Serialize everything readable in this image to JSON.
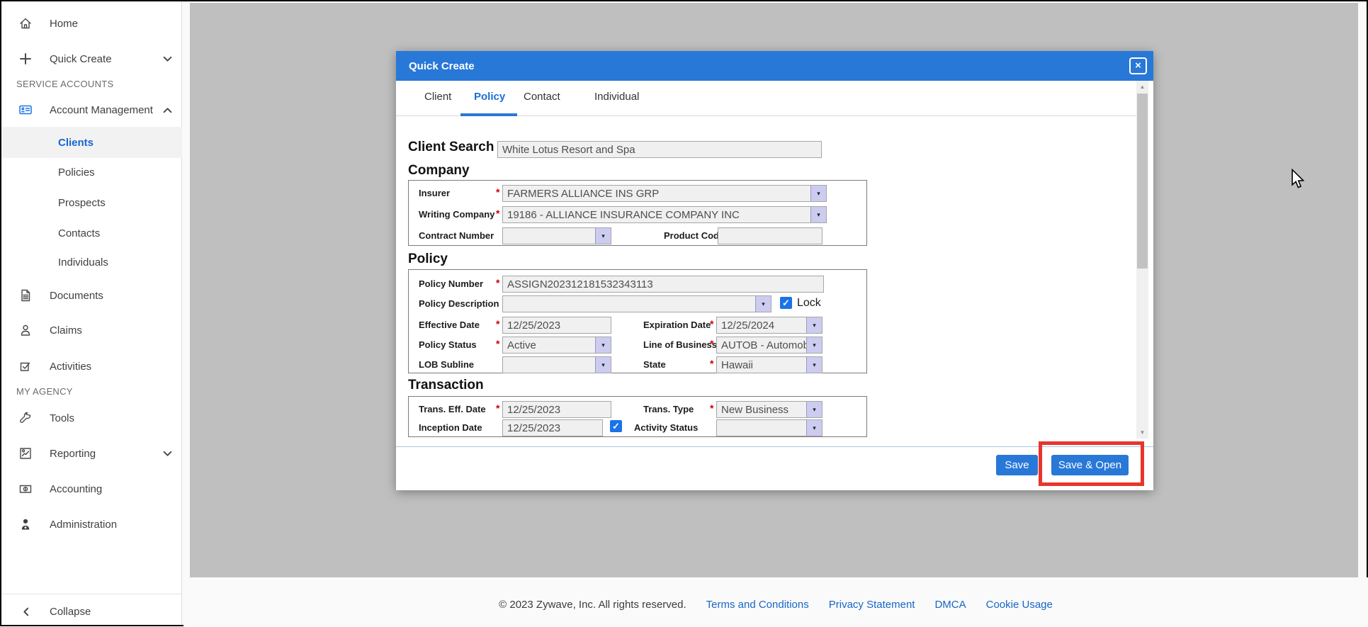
{
  "colors": {
    "accent_blue": "#2878d7",
    "annotation_red": "#e8352b",
    "link_blue": "#1766c8",
    "active_item_blue": "#1467d2",
    "checkbox_blue": "#1a73e8",
    "content_gray": "#bfbfbf"
  },
  "ui": {
    "required_marker": "*",
    "check_glyph": "✓",
    "dropdown_arrow": "▾",
    "scroll_up": "▲",
    "scroll_down": "▼",
    "close_glyph": "×"
  },
  "sidebar": {
    "home": "Home",
    "quick_create": "Quick Create",
    "section_service_accounts": "SERVICE ACCOUNTS",
    "account_management": "Account Management",
    "clients": "Clients",
    "policies": "Policies",
    "prospects": "Prospects",
    "contacts": "Contacts",
    "individuals": "Individuals",
    "documents": "Documents",
    "claims": "Claims",
    "activities": "Activities",
    "section_my_agency": "MY AGENCY",
    "tools": "Tools",
    "reporting": "Reporting",
    "accounting": "Accounting",
    "administration": "Administration",
    "collapse": "Collapse"
  },
  "modal": {
    "title": "Quick Create",
    "tabs": {
      "client": "Client",
      "policy": "Policy",
      "contact": "Contact",
      "individual": "Individual"
    },
    "client_search": {
      "label": "Client Search",
      "value": "White Lotus Resort and Spa"
    },
    "company": {
      "title": "Company",
      "insurer_label": "Insurer",
      "insurer_value": "FARMERS ALLIANCE INS GRP",
      "writing_label": "Writing Company",
      "writing_value": "19186 - ALLIANCE INSURANCE COMPANY INC",
      "contract_label": "Contract Number",
      "contract_value": "",
      "product_label": "Product Code",
      "product_value": ""
    },
    "policy": {
      "title": "Policy",
      "number_label": "Policy Number",
      "number_value": "ASSIGN202312181532343113",
      "description_label": "Policy Description",
      "description_value": "",
      "lock_label": "Lock",
      "effective_label": "Effective Date",
      "effective_value": "12/25/2023",
      "expiration_label": "Expiration Date",
      "expiration_value": "12/25/2024",
      "status_label": "Policy Status",
      "status_value": "Active",
      "lob_label": "Line of Business",
      "lob_value": "AUTOB - Automob",
      "subline_label": "LOB Subline",
      "subline_value": "",
      "state_label": "State",
      "state_value": "Hawaii"
    },
    "transaction": {
      "title": "Transaction",
      "trans_eff_label": "Trans. Eff. Date",
      "trans_eff_value": "12/25/2023",
      "trans_type_label": "Trans. Type",
      "trans_type_value": "New Business",
      "inception_label": "Inception Date",
      "inception_value": "12/25/2023",
      "activity_label": "Activity Status",
      "activity_value": ""
    },
    "buttons": {
      "save": "Save",
      "save_open": "Save & Open"
    }
  },
  "page_footer": {
    "copyright": "© 2023 Zywave, Inc. All rights reserved.",
    "links": [
      "Terms and Conditions",
      "Privacy Statement",
      "DMCA",
      "Cookie Usage"
    ]
  }
}
